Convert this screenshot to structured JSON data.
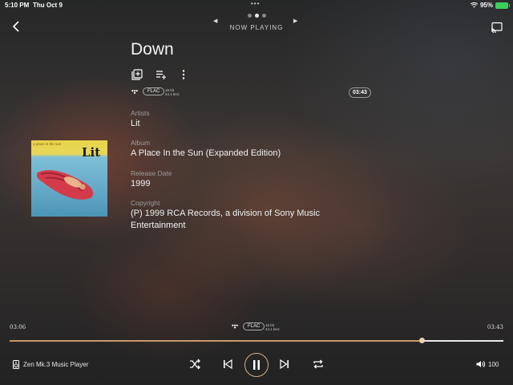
{
  "status_bar": {
    "time": "5:10 PM",
    "date": "Thu Oct 9",
    "battery": "95%"
  },
  "header": {
    "title": "NOW PLAYING"
  },
  "track": {
    "title": "Down",
    "format": "FLAC",
    "bit_depth": "16 bit",
    "sample_rate": "44.1 kHz",
    "duration": "03:43"
  },
  "details": {
    "artists_label": "Artists",
    "artists": "Lit",
    "album_label": "Album",
    "album": "A Place In the Sun (Expanded Edition)",
    "release_label": "Release Date",
    "release": "1999",
    "copyright_label": "Copyright",
    "copyright_line1": "(P) 1999 RCA Records, a division of Sony Music",
    "copyright_line2": "Entertainment"
  },
  "album_art": {
    "small_text": "a place in the sun",
    "logo": "Lit"
  },
  "player": {
    "elapsed": "03:06",
    "total": "03:43",
    "progress": 0.836,
    "format": "FLAC",
    "bit_depth": "16 bit",
    "sample_rate": "44.1 kHz",
    "device": "Zen Mk.3 Music Player",
    "volume": "100"
  },
  "colors": {
    "accent": "#c49a6c",
    "battery": "#3ad15a"
  }
}
